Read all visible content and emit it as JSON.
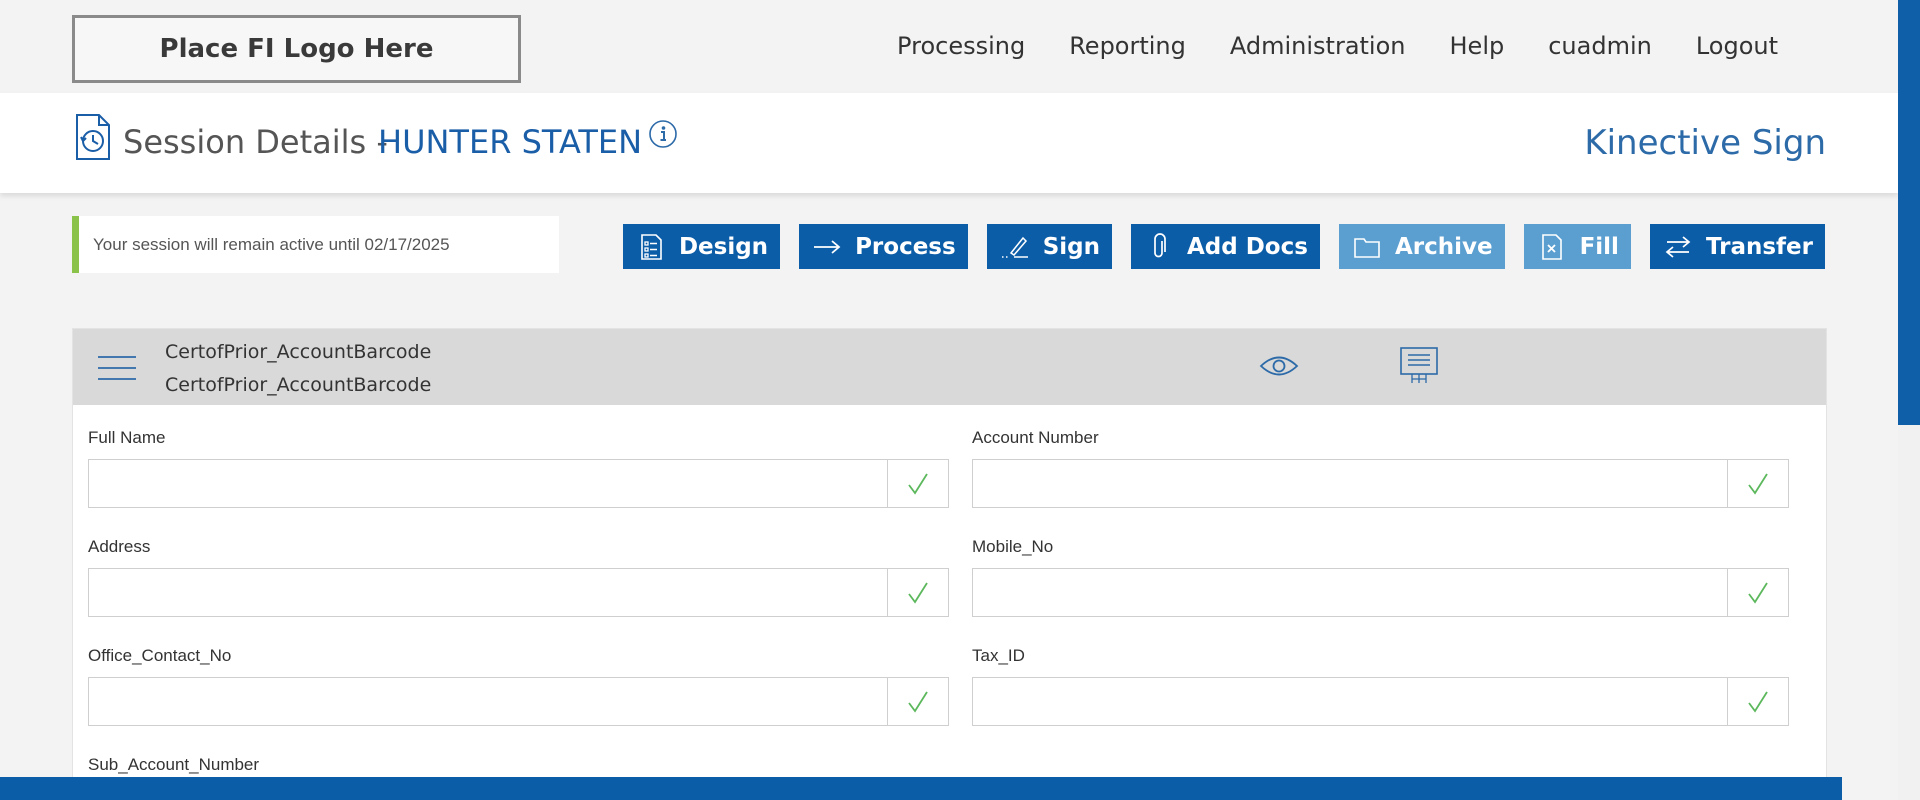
{
  "logo": {
    "text": "Place FI Logo Here"
  },
  "nav": {
    "processing": "Processing",
    "reporting": "Reporting",
    "administration": "Administration",
    "help": "Help",
    "user": "cuadmin",
    "logout": "Logout"
  },
  "header": {
    "title_prefix": "Session Details -",
    "customer_name": "HUNTER STATEN",
    "brand": "Kinective Sign"
  },
  "notice": {
    "text": "Your session will remain active until 02/17/2025"
  },
  "actions": {
    "design": "Design",
    "process": "Process",
    "sign": "Sign",
    "add_docs": "Add Docs",
    "archive": "Archive",
    "fill": "Fill",
    "transfer": "Transfer"
  },
  "document": {
    "name_line1": "CertofPrior_AccountBarcode",
    "name_line2": "CertofPrior_AccountBarcode"
  },
  "fields": {
    "full_name": {
      "label": "Full Name",
      "value": ""
    },
    "account_number": {
      "label": "Account Number",
      "value": ""
    },
    "address": {
      "label": "Address",
      "value": ""
    },
    "mobile_no": {
      "label": "Mobile_No",
      "value": ""
    },
    "office_contact_no": {
      "label": "Office_Contact_No",
      "value": ""
    },
    "tax_id": {
      "label": "Tax_ID",
      "value": ""
    },
    "sub_account_number": {
      "label": "Sub_Account_Number"
    }
  },
  "colors": {
    "primary": "#0c5da8",
    "primary_light": "#5b9fd1",
    "accent_green": "#8bc34a",
    "title_blue": "#1b5ea8"
  },
  "icons": {
    "session_history": "history-document-icon",
    "info": "info-icon",
    "design": "checklist-icon",
    "process": "arrow-right-icon",
    "sign": "pen-icon",
    "add_docs": "paperclip-icon",
    "archive": "folder-icon",
    "fill": "document-x-icon",
    "transfer": "swap-arrows-icon",
    "menu": "hamburger-icon",
    "preview": "eye-icon",
    "present": "presentation-icon",
    "valid": "checkmark-icon"
  }
}
